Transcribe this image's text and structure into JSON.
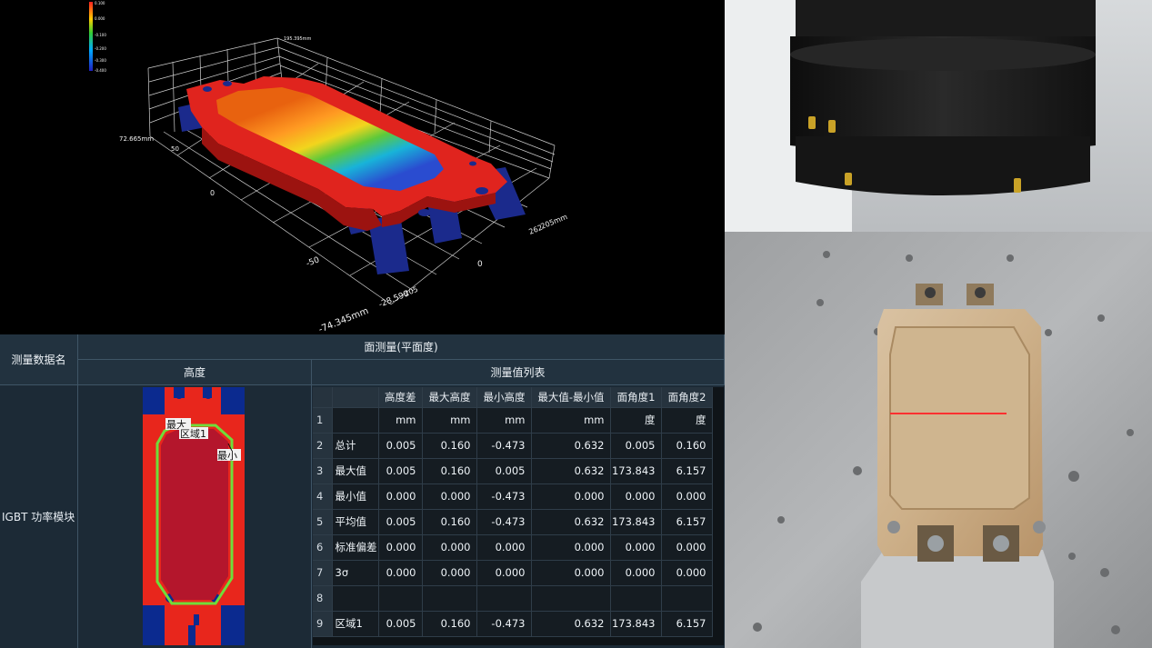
{
  "viewer": {
    "legend_ticks": [
      "0.100",
      "0.000",
      "-0.100",
      "-0.200",
      "-0.300",
      "-0.400"
    ],
    "top_right_label": "195.395mm",
    "left_label": "72.665mm",
    "tick_50_left": "50",
    "tick_0_left": "0",
    "tick_neg50": "-50",
    "tick_0_bottom": "0",
    "right_label_a": "262",
    "right_label_b": "205mm",
    "bottom_label_a": "-74.345mm",
    "bottom_label_b": "-28.590",
    "bottom_label_c": "205"
  },
  "table": {
    "col_name_header": "测量数据名",
    "surface_header": "面测量(平面度)",
    "height_header": "高度",
    "list_header": "测量值列表",
    "row_name": "IGBT 功率模块",
    "heightmap_labels": {
      "max": "最大",
      "region": "区域1",
      "min": "最小"
    },
    "columns": [
      "高度差",
      "最大高度",
      "最小高度",
      "最大值-最小值",
      "面角度1",
      "面角度2"
    ],
    "rows": [
      {
        "no": "1",
        "label": "",
        "values": [
          "mm",
          "mm",
          "mm",
          "mm",
          "度",
          "度"
        ]
      },
      {
        "no": "2",
        "label": "总计",
        "values": [
          "0.005",
          "0.160",
          "-0.473",
          "0.632",
          "0.005",
          "0.160"
        ]
      },
      {
        "no": "3",
        "label": "最大值",
        "values": [
          "0.005",
          "0.160",
          "0.005",
          "0.632",
          "173.843",
          "6.157"
        ]
      },
      {
        "no": "4",
        "label": "最小值",
        "values": [
          "0.000",
          "0.000",
          "-0.473",
          "0.000",
          "0.000",
          "0.000"
        ]
      },
      {
        "no": "5",
        "label": "平均值",
        "values": [
          "0.005",
          "0.160",
          "-0.473",
          "0.632",
          "173.843",
          "6.157"
        ]
      },
      {
        "no": "6",
        "label": "标准偏差",
        "values": [
          "0.000",
          "0.000",
          "0.000",
          "0.000",
          "0.000",
          "0.000"
        ]
      },
      {
        "no": "7",
        "label": "3σ",
        "values": [
          "0.000",
          "0.000",
          "0.000",
          "0.000",
          "0.000",
          "0.000"
        ]
      },
      {
        "no": "8",
        "label": "",
        "values": [
          "",
          "",
          "",
          "",
          "",
          ""
        ]
      },
      {
        "no": "9",
        "label": "区域1",
        "values": [
          "0.005",
          "0.160",
          "-0.473",
          "0.632",
          "173.843",
          "6.157"
        ]
      }
    ]
  },
  "colors": {
    "panel_bg": "#1c2a36",
    "header_bg": "#22323f",
    "heightmap_red": "#e8261c",
    "heightmap_blue": "#0b2a8f"
  }
}
